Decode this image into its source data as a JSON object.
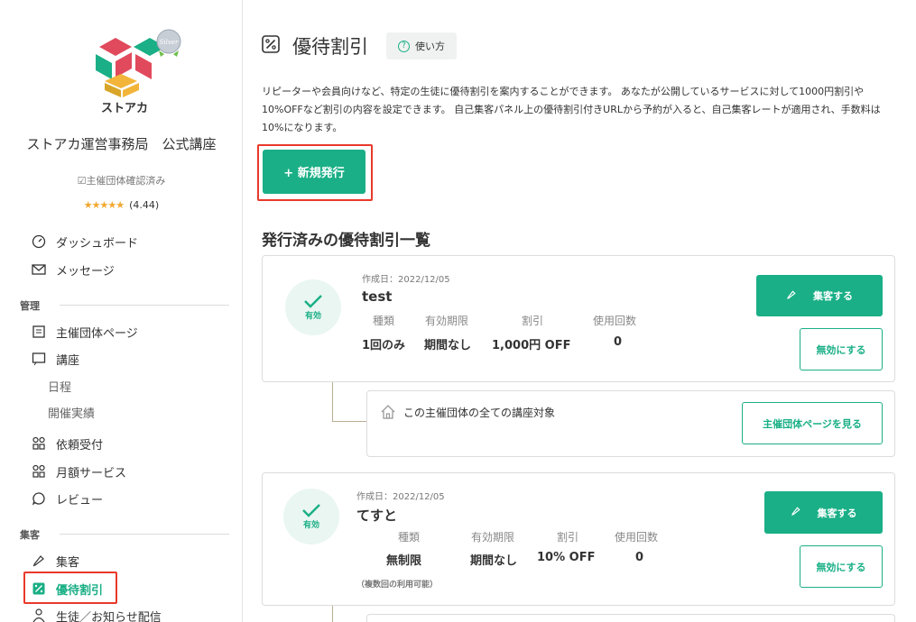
{
  "sidebar": {
    "logo_text": "ストアカ",
    "badge_text": "Silver",
    "org_name": "ストアカ運営事務局　公式講座",
    "verified": "主催団体確認済み",
    "rating": "(4.44)",
    "stars": "★★★★★",
    "nav": {
      "dashboard": "ダッシュボード",
      "messages": "メッセージ",
      "section_manage": "管理",
      "org_page": "主催団体ページ",
      "courses": "講座",
      "schedule": "日程",
      "history": "開催実績",
      "requests": "依頼受付",
      "monthly": "月額サービス",
      "reviews": "レビュー",
      "section_marketing": "集客",
      "marketing": "集客",
      "coupons": "優待割引",
      "students": "生徒／お知らせ配信"
    }
  },
  "main": {
    "title": "優待割引",
    "howto": "使い方",
    "description": "リピーターや会員向けなど、特定の生徒に優待割引を案内することができます。 あなたが公開しているサービスに対して1000円割引や10%OFFなど割引の内容を設定できます。 自己集客パネル上の優待割引付きURLから予約が入ると、自己集客レートが適用され、手数料は10%になります。",
    "new_button": "+ 新規発行",
    "list_title": "発行済みの優待割引一覧",
    "headers": {
      "type": "種類",
      "period": "有効期限",
      "discount": "割引",
      "uses": "使用回数"
    },
    "coupons": [
      {
        "status": "有効",
        "created": "作成日：2022/12/05",
        "name": "test",
        "type": "1回のみ",
        "period": "期間なし",
        "discount": "1,000円 OFF",
        "uses": "0",
        "promote": "集客する",
        "disable": "無効にする",
        "target": "この主催団体の全ての講座対象",
        "view_org": "主催団体ページを見る"
      },
      {
        "status": "有効",
        "created": "作成日：2022/12/05",
        "name": "てすと",
        "type": "無制限",
        "period": "期間なし",
        "discount": "10% OFF",
        "uses": "0",
        "note": "（複数回の利用可能）",
        "promote": "集客する",
        "disable": "無効にする"
      }
    ]
  },
  "colors": {
    "accent": "#1aaf86",
    "highlight": "#e8392b"
  }
}
